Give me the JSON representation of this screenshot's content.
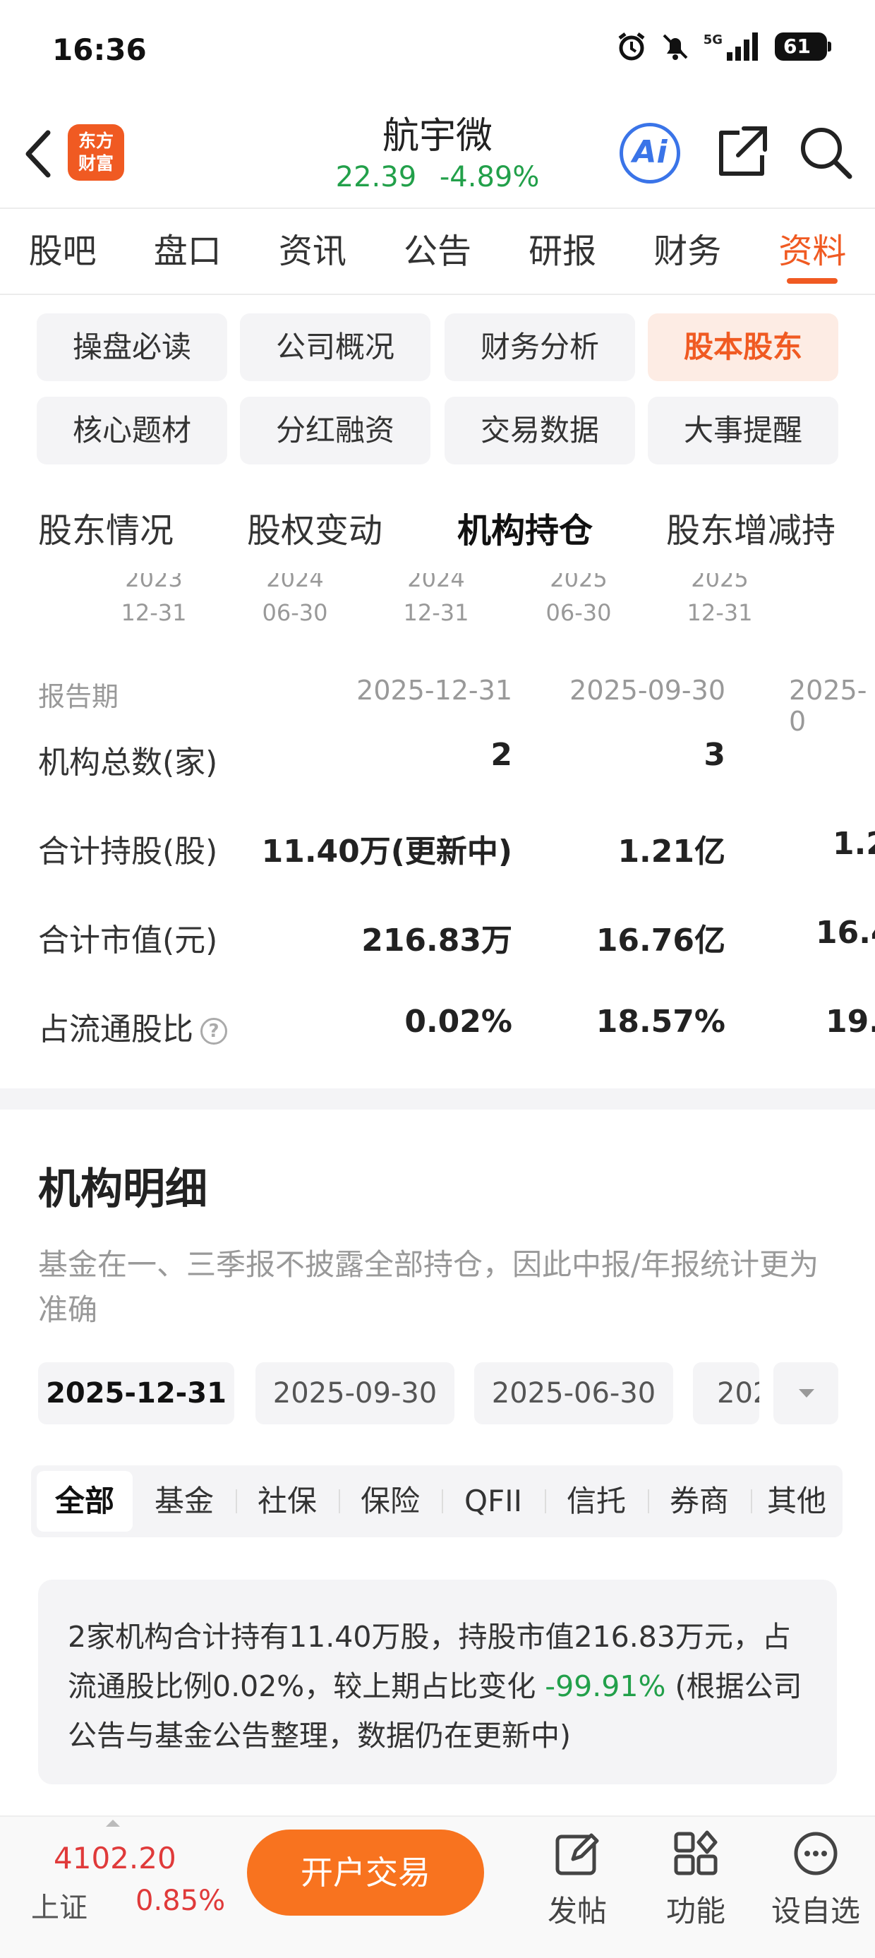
{
  "status_bar": {
    "time": "16:36",
    "network": "5G",
    "battery": "61"
  },
  "header": {
    "logo_line1": "东方",
    "logo_line2": "财富",
    "stock_name": "航宇微",
    "price": "22.39",
    "change": "-4.89%",
    "ai_label": "Ai",
    "colors": {
      "down": "#22a04a",
      "accent": "#f05a22"
    }
  },
  "main_tabs": [
    {
      "label": "股吧"
    },
    {
      "label": "盘口"
    },
    {
      "label": "资讯"
    },
    {
      "label": "公告"
    },
    {
      "label": "研报"
    },
    {
      "label": "财务"
    },
    {
      "label": "资料",
      "active": true
    }
  ],
  "sub_tabs": [
    {
      "label": "操盘必读"
    },
    {
      "label": "公司概况"
    },
    {
      "label": "财务分析"
    },
    {
      "label": "股本股东",
      "active": true
    },
    {
      "label": "核心题材"
    },
    {
      "label": "分红融资"
    },
    {
      "label": "交易数据"
    },
    {
      "label": "大事提醒"
    }
  ],
  "section_tabs": [
    {
      "label": "股东情况"
    },
    {
      "label": "股权变动"
    },
    {
      "label": "机构持仓",
      "active": true
    },
    {
      "label": "股东增减持"
    }
  ],
  "timeline": [
    {
      "year": "2023",
      "md": "12-31"
    },
    {
      "year": "2024",
      "md": "06-30"
    },
    {
      "year": "2024",
      "md": "12-31"
    },
    {
      "year": "2025",
      "md": "06-30"
    },
    {
      "year": "2025",
      "md": "12-31"
    }
  ],
  "holdings_table": {
    "header_label": "报告期",
    "periods": [
      "2025-12-31",
      "2025-09-30",
      "2025-0"
    ],
    "rows": [
      {
        "label": "机构总数(家)",
        "values": [
          "2",
          "3",
          ""
        ]
      },
      {
        "label": "合计持股(股)",
        "values": [
          "11.40万(更新中)",
          "1.21亿",
          "1.2"
        ]
      },
      {
        "label": "合计市值(元)",
        "values": [
          "216.83万",
          "16.76亿",
          "16.4"
        ]
      },
      {
        "label": "占流通股比",
        "values": [
          "0.02%",
          "18.57%",
          "19."
        ]
      }
    ]
  },
  "detail": {
    "title": "机构明细",
    "note": "基金在一、三季报不披露全部持仓，因此中报/年报统计更为准确",
    "dates": [
      "2025-12-31",
      "2025-09-30",
      "2025-06-30",
      "202"
    ],
    "filters": [
      "全部",
      "基金",
      "社保",
      "保险",
      "QFII",
      "信托",
      "券商",
      "其他"
    ],
    "summary_prefix": "2家机构合计持有11.40万股，持股市值216.83万元，占流通股比例0.02%，较上期占比变化 ",
    "summary_change": "-99.91%",
    "summary_suffix": " (根据公司公告与基金公告整理，数据仍在更新中)"
  },
  "bottom_bar": {
    "index_value": "4102.20",
    "index_name": "上证",
    "index_change": "0.85%",
    "trade_button": "开户交易",
    "nav": [
      {
        "label": "发帖",
        "icon": "edit-icon"
      },
      {
        "label": "功能",
        "icon": "grid-icon"
      },
      {
        "label": "设自选",
        "icon": "chat-icon"
      }
    ]
  }
}
